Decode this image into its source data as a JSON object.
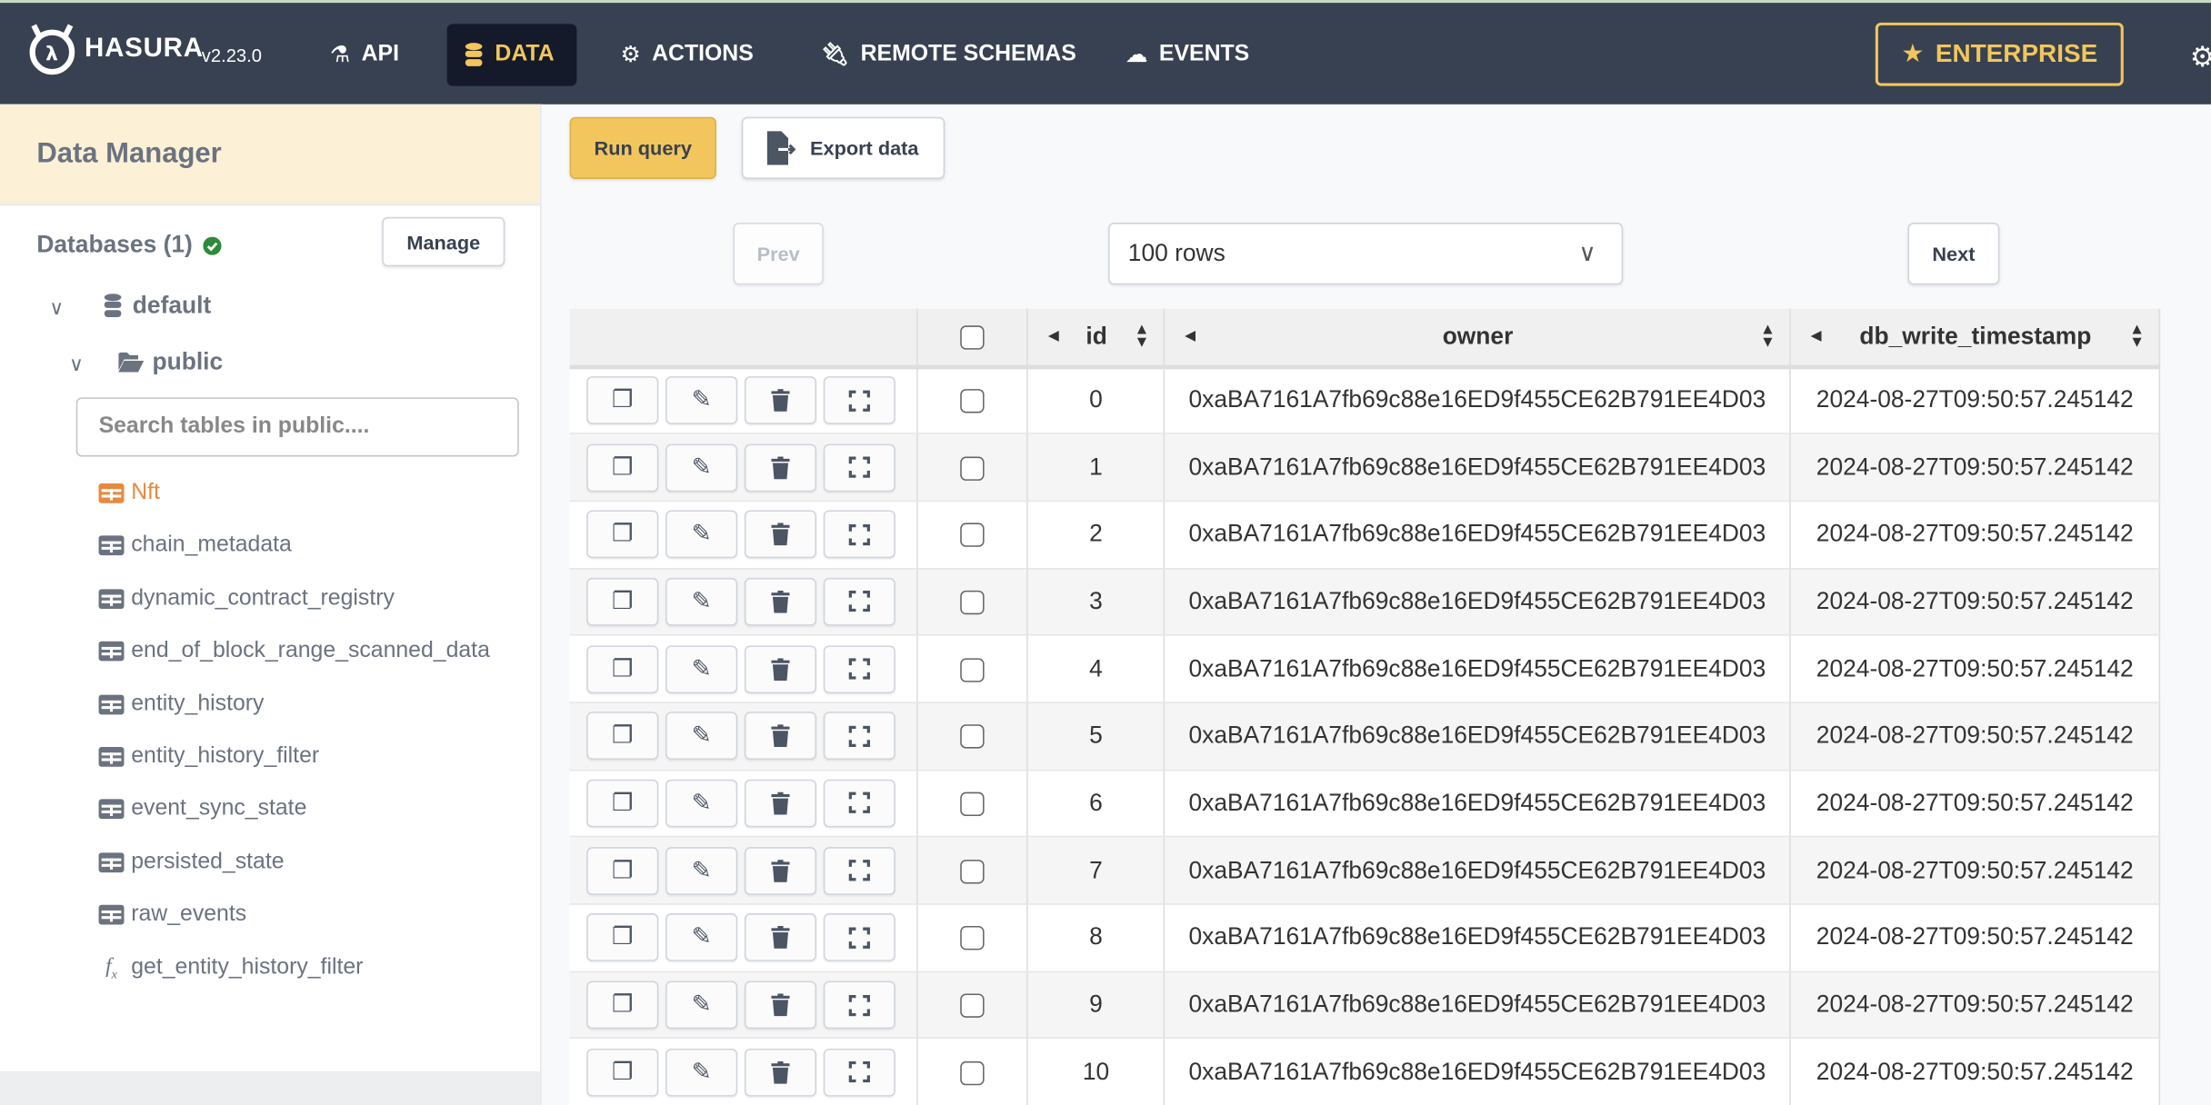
{
  "nav": {
    "brand": "HASURA",
    "version": "v2.23.0",
    "items": [
      {
        "label": "API",
        "icon": "flask-icon"
      },
      {
        "label": "DATA",
        "icon": "database-icon",
        "active": true
      },
      {
        "label": "ACTIONS",
        "icon": "cogs-icon"
      },
      {
        "label": "REMOTE SCHEMAS",
        "icon": "plug-icon"
      },
      {
        "label": "EVENTS",
        "icon": "cloud-icon"
      }
    ],
    "enterprise_label": "ENTERPRISE",
    "accent": "#f2c65c"
  },
  "sidebar": {
    "title": "Data Manager",
    "databases_label": "Databases (1)",
    "manage_label": "Manage",
    "database": "default",
    "schema": "public",
    "search_placeholder": "Search tables in public....",
    "items": [
      {
        "label": "Nft",
        "type": "table",
        "active": true
      },
      {
        "label": "chain_metadata",
        "type": "table"
      },
      {
        "label": "dynamic_contract_registry",
        "type": "table"
      },
      {
        "label": "end_of_block_range_scanned_data",
        "type": "table"
      },
      {
        "label": "entity_history",
        "type": "table"
      },
      {
        "label": "entity_history_filter",
        "type": "table"
      },
      {
        "label": "event_sync_state",
        "type": "table"
      },
      {
        "label": "persisted_state",
        "type": "table"
      },
      {
        "label": "raw_events",
        "type": "table"
      },
      {
        "label": "get_entity_history_filter",
        "type": "function"
      }
    ]
  },
  "toolbar": {
    "run_query": "Run query",
    "export_data": "Export data",
    "prev": "Prev",
    "next": "Next",
    "rows_select": "100 rows"
  },
  "table": {
    "columns": [
      "id",
      "owner",
      "db_write_timestamp"
    ],
    "rows": [
      {
        "id": "0",
        "owner": "0xaBA7161A7fb69c88e16ED9f455CE62B791EE4D03",
        "ts": "2024-08-27T09:50:57.245142"
      },
      {
        "id": "1",
        "owner": "0xaBA7161A7fb69c88e16ED9f455CE62B791EE4D03",
        "ts": "2024-08-27T09:50:57.245142"
      },
      {
        "id": "2",
        "owner": "0xaBA7161A7fb69c88e16ED9f455CE62B791EE4D03",
        "ts": "2024-08-27T09:50:57.245142"
      },
      {
        "id": "3",
        "owner": "0xaBA7161A7fb69c88e16ED9f455CE62B791EE4D03",
        "ts": "2024-08-27T09:50:57.245142"
      },
      {
        "id": "4",
        "owner": "0xaBA7161A7fb69c88e16ED9f455CE62B791EE4D03",
        "ts": "2024-08-27T09:50:57.245142"
      },
      {
        "id": "5",
        "owner": "0xaBA7161A7fb69c88e16ED9f455CE62B791EE4D03",
        "ts": "2024-08-27T09:50:57.245142"
      },
      {
        "id": "6",
        "owner": "0xaBA7161A7fb69c88e16ED9f455CE62B791EE4D03",
        "ts": "2024-08-27T09:50:57.245142"
      },
      {
        "id": "7",
        "owner": "0xaBA7161A7fb69c88e16ED9f455CE62B791EE4D03",
        "ts": "2024-08-27T09:50:57.245142"
      },
      {
        "id": "8",
        "owner": "0xaBA7161A7fb69c88e16ED9f455CE62B791EE4D03",
        "ts": "2024-08-27T09:50:57.245142"
      },
      {
        "id": "9",
        "owner": "0xaBA7161A7fb69c88e16ED9f455CE62B791EE4D03",
        "ts": "2024-08-27T09:50:57.245142"
      },
      {
        "id": "10",
        "owner": "0xaBA7161A7fb69c88e16ED9f455CE62B791EE4D03",
        "ts": "2024-08-27T09:50:57.245142"
      }
    ]
  }
}
